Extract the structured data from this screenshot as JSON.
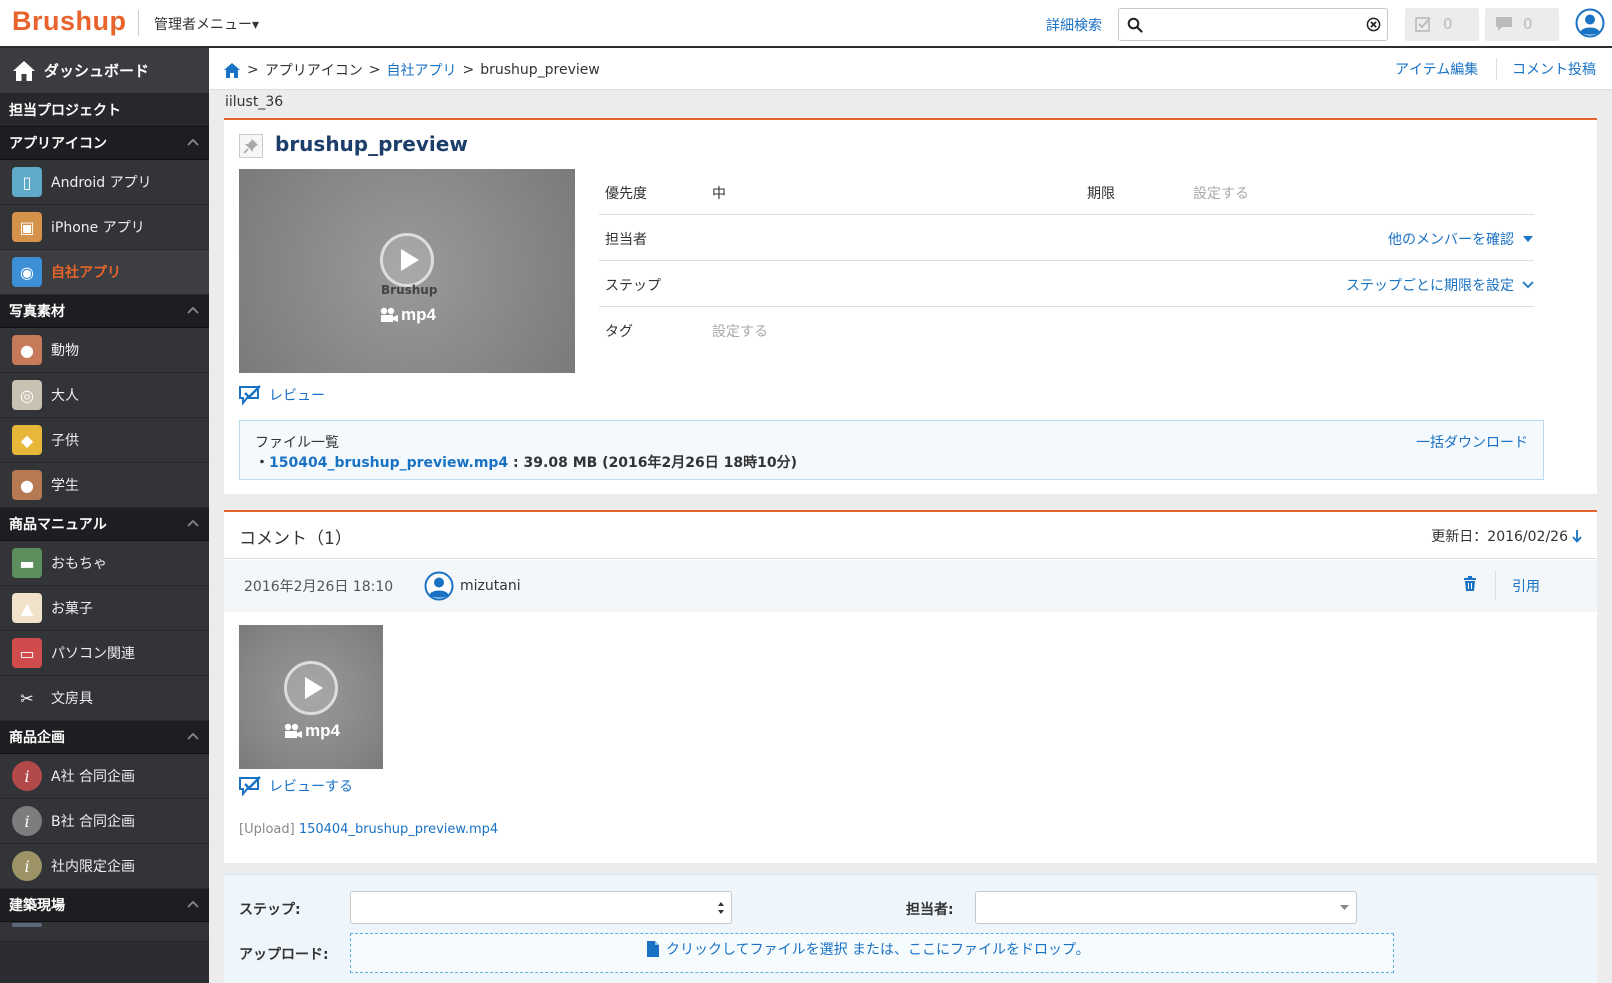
{
  "header": {
    "logo": "Brushup",
    "admin_menu": "管理者メニュー▾",
    "advanced_search": "詳細検索",
    "search_placeholder": "",
    "task_count": "0",
    "comment_count": "0"
  },
  "sidebar": {
    "dashboard": "ダッシュボード",
    "my_projects": "担当プロジェクト",
    "sections": [
      {
        "title": "アプリアイコン",
        "items": [
          {
            "label": "Android アプリ",
            "icon": "android-app-icon",
            "color": "#5fa9c9"
          },
          {
            "label": "iPhone アプリ",
            "icon": "iphone-app-icon",
            "color": "#d4924a"
          },
          {
            "label": "自社アプリ",
            "icon": "company-app-icon",
            "color": "#3d8fd6",
            "active": true
          }
        ]
      },
      {
        "title": "写真素材",
        "items": [
          {
            "label": "動物",
            "icon": "monkey-icon",
            "color": "#c77a5a"
          },
          {
            "label": "大人",
            "icon": "glasses-face-icon",
            "color": "#c9c2b2"
          },
          {
            "label": "子供",
            "icon": "duck-icon",
            "color": "#e8b73a"
          },
          {
            "label": "学生",
            "icon": "student-icon",
            "color": "#b57a52"
          }
        ]
      },
      {
        "title": "商品マニュアル",
        "items": [
          {
            "label": "おもちゃ",
            "icon": "toy-car-icon",
            "color": "#5c8f5e"
          },
          {
            "label": "お菓子",
            "icon": "cupcake-icon",
            "color": "#f0e2c9"
          },
          {
            "label": "パソコン関連",
            "icon": "computer-icon",
            "color": "#d04b4b"
          },
          {
            "label": "文房具",
            "icon": "scissors-icon",
            "color": "#323438"
          }
        ]
      },
      {
        "title": "商品企画",
        "items": [
          {
            "label": "A社 合同企画",
            "icon": "info-red-icon",
            "color": "#b24a4a"
          },
          {
            "label": "B社 合同企画",
            "icon": "info-gray-icon",
            "color": "#7d7d7d"
          },
          {
            "label": "社内限定企画",
            "icon": "info-olive-icon",
            "color": "#9c9466"
          }
        ]
      },
      {
        "title": "建築現場",
        "items": []
      }
    ]
  },
  "breadcrumb": {
    "items": [
      "アプリアイコン",
      "自社アプリ",
      "brushup_preview"
    ],
    "separator": ">"
  },
  "actions": {
    "item_edit": "アイテム編集",
    "comment_post": "コメント投稿"
  },
  "item": {
    "code": "iilust_36",
    "title": "brushup_preview",
    "preview_brand": "Brushup",
    "preview_format": "mp4",
    "review_label": "レビュー",
    "properties": {
      "priority_label": "優先度",
      "priority_value": "中",
      "deadline_label": "期限",
      "deadline_value": "設定する",
      "assignee_label": "担当者",
      "assignee_action": "他のメンバーを確認",
      "step_label": "ステップ",
      "step_action": "ステップごとに期限を設定",
      "tag_label": "タグ",
      "tag_value": "設定する"
    },
    "files": {
      "title": "ファイル一覧",
      "download_all": "一括ダウンロード",
      "bullet": "・",
      "filename": "150404_brushup_preview.mp4",
      "details": " : 39.08 MB (2016年2月26日 18時10分)"
    }
  },
  "comments": {
    "title": "コメント（1）",
    "updated": "更新日：2016/02/26",
    "entries": [
      {
        "date": "2016年2月26日 18:10",
        "user": "mizutani",
        "quote": "引用",
        "thumb_format": "mp4",
        "review_label": "レビューする",
        "upload_prefix": "[Upload] ",
        "upload_file": "150404_brushup_preview.mp4"
      }
    ]
  },
  "form": {
    "step_label": "ステップ:",
    "assignee_label": "担当者:",
    "upload_label": "アップロード:",
    "dropzone_text": "クリックしてファイルを選択 または、ここにファイルをドロップ。"
  },
  "colors": {
    "accent": "#e8642c",
    "link": "#1a72c4",
    "sidebar": "#2b2d30"
  }
}
